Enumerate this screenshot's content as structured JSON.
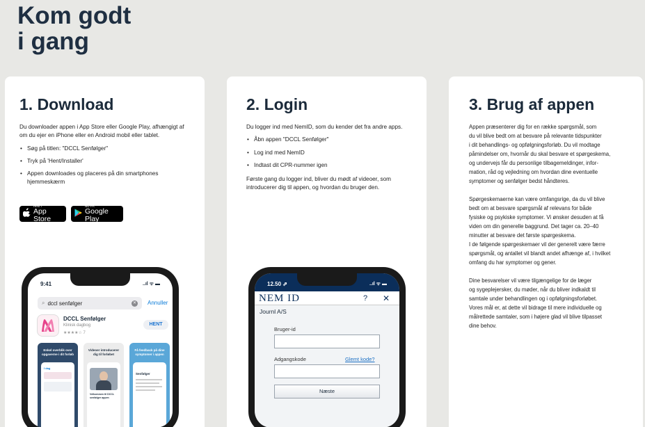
{
  "page": {
    "title_line1": "Kom godt",
    "title_line2": "i gang"
  },
  "download": {
    "heading": "1. Download",
    "intro": "Du downloader appen i App Store eller Google Play, afhængigt af om du ejer en iPhone eller en Android mobil eller tablet.",
    "bullets": [
      "Søg på titlen: \"DCCL Senfølger\"",
      "Tryk på 'Hent/Installer'",
      "Appen downloades og placeres på din smartphones hjemmeskærm"
    ],
    "app_store": {
      "small": "Hent i",
      "big": "App Store",
      "icon": "apple-icon"
    },
    "google_play": {
      "small": "NU PÅ",
      "big": "Google Play",
      "icon": "google-play-icon"
    },
    "phone": {
      "time": "9:41",
      "status": "..ıl ᯤ ▬",
      "search_value": "dccl senfølger",
      "cancel": "Annuller",
      "app_name": "DCCL Senfølger",
      "app_category": "Klinisk dagbog",
      "rating": "★★★★☆ 7",
      "get": "HENT",
      "shot1": "Enkel overblik over opgaverne i dit forløb",
      "shot2": "Videoer introducerer dig til forløbet",
      "shot3": "Få feedback på dine symptomer i appen",
      "today": "I dag",
      "welcome": "Velkommen til DCCL senfølger appen",
      "symptoms": "Senfølger"
    }
  },
  "login": {
    "heading": "2. Login",
    "intro": "Du logger ind med NemID, som du kender det fra andre apps.",
    "bullets": [
      "Åbn appen \"DCCL Senfølger\"",
      "Log ind med NemID",
      "Indtast dit CPR-nummer igen"
    ],
    "outro": "Første gang du logger ind, bliver du mødt af videoer, som introducerer dig til appen, og hvordan du bruger den.",
    "phone": {
      "time": "12.50 ⇗",
      "status": "..ıl ᯤ ▬",
      "brand": "NEM ID",
      "help": "?",
      "close": "✕",
      "subtitle": "Journl A/S",
      "user_label": "Bruger-id",
      "password_label": "Adgangskode",
      "forgot": "Glemt kode?",
      "next": "Næste"
    }
  },
  "usage": {
    "heading": "3. Brug af appen",
    "p1": [
      "Appen præsenterer dig for en række spørgsmål, som",
      "du vil blive bedt om at besvare på relevante tidspunkter",
      "i dit behandlings- og opfølgningsforløb. Du vil modtage",
      "påmindelser om, hvornår du skal besvare et spørgeskema,",
      "og undervejs får du personlige tilbagemeldinger, infor-",
      "mation, råd og vejledning om hvordan dine eventuelle",
      "symptomer og senfølger bedst håndteres."
    ],
    "p2": [
      "Spørgeskemaerne kan være omfangsrige, da du vil blive",
      "bedt om at besvare spørgsmål af relevans for både",
      "fysiske og psykiske symptomer. Vi ønsker desuden at få",
      "viden om din generelle baggrund. Det tager ca. 20–40",
      "minutter at besvare det første spørgeskema.",
      "I de følgende spørgeskemaer vil der generelt være færre",
      "spørgsmål, og antallet vil blandt andet afhænge af, i hvilket",
      "omfang du har symptomer og gener."
    ],
    "p3": [
      "Dine besvarelser vil være tilgængelige for de læger",
      "og sygeplejersker, du møder, når du bliver indkaldt til",
      "samtale under behandlingen og i opfølgningsforløbet.",
      "Vores mål er, at dette vil bidrage til mere individuelle og",
      "målrettede samtaler, som i højere glad vil blive tilpasset",
      "dine behov."
    ]
  },
  "colors": {
    "accent_blue": "#0a7bd8",
    "hent_blue": "#1a73d1",
    "nemid_navy": "#0b2e5a"
  }
}
